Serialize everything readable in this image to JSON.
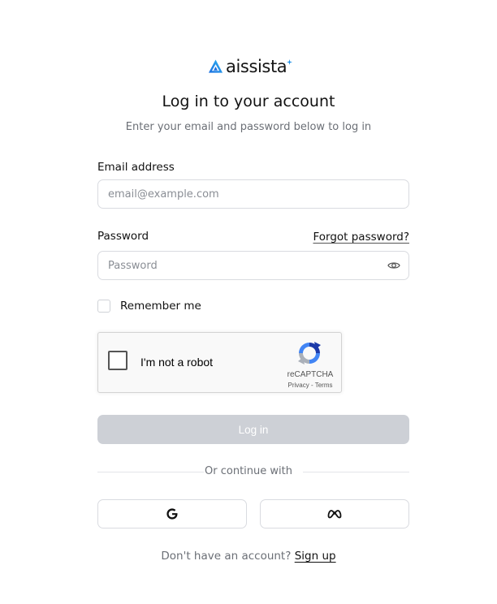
{
  "brand": {
    "name": "aissista",
    "accent_color": "#1f8fe5",
    "icon": "aissista-logo-icon"
  },
  "header": {
    "title": "Log in to your account",
    "subtitle": "Enter your email and password below to log in"
  },
  "email": {
    "label": "Email address",
    "placeholder": "email@example.com",
    "value": ""
  },
  "password": {
    "label": "Password",
    "placeholder": "Password",
    "value": "",
    "forgot_label": "Forgot password?",
    "toggle_icon": "eye-icon"
  },
  "remember": {
    "label": "Remember me",
    "checked": false
  },
  "recaptcha": {
    "label": "I'm not a robot",
    "brand": "reCAPTCHA",
    "privacy": "Privacy",
    "separator": " - ",
    "terms": "Terms",
    "checked": false
  },
  "login_button": {
    "label": "Log in",
    "disabled": true,
    "color": "#cdd0d6"
  },
  "divider": {
    "text": "Or continue with"
  },
  "social": {
    "google_icon": "google-icon",
    "meta_icon": "meta-icon"
  },
  "footer": {
    "prompt": "Don't have an account?",
    "signup_label": "Sign up"
  }
}
